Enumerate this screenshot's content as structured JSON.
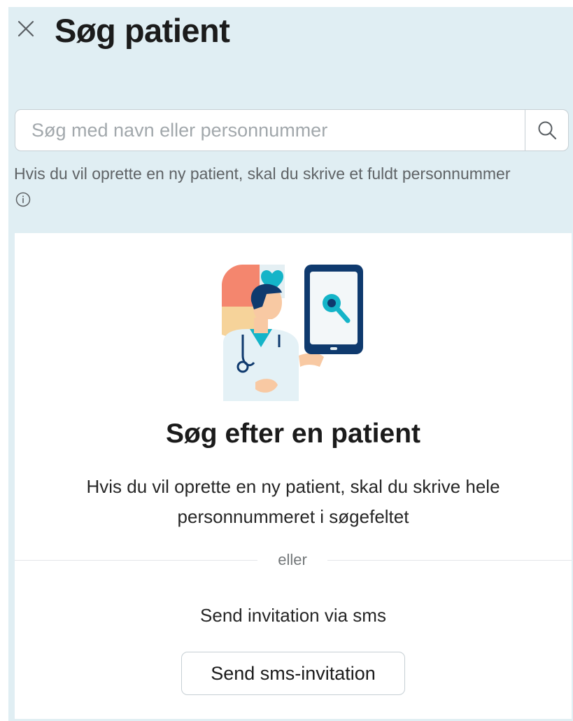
{
  "header": {
    "title": "Søg patient",
    "close_icon": "close-icon"
  },
  "search": {
    "placeholder": "Søg med navn eller personnummer",
    "value": "",
    "search_icon": "search-icon"
  },
  "hint": {
    "text": "Hvis du vil oprette en ny patient, skal du skrive et fuldt personnummer",
    "info_icon": "info-icon"
  },
  "empty_state": {
    "illustration": "doctor-with-phone-illustration",
    "title": "Søg efter en patient",
    "description": "Hvis du vil oprette en ny patient, skal du skrive hele personnummeret i søgefeltet"
  },
  "divider": {
    "label": "eller"
  },
  "sms": {
    "text": "Send invitation via sms",
    "button_label": "Send sms-invitation"
  },
  "colors": {
    "panel_background": "#e0eef3",
    "card_background": "#ffffff",
    "title_text": "#1b1b1b",
    "hint_text": "#5f6366",
    "border": "#c6cfd4",
    "illustration_navy": "#0f3a6e",
    "illustration_teal": "#14b4c8",
    "illustration_coral": "#f4866e",
    "illustration_sand": "#f6d39a"
  }
}
